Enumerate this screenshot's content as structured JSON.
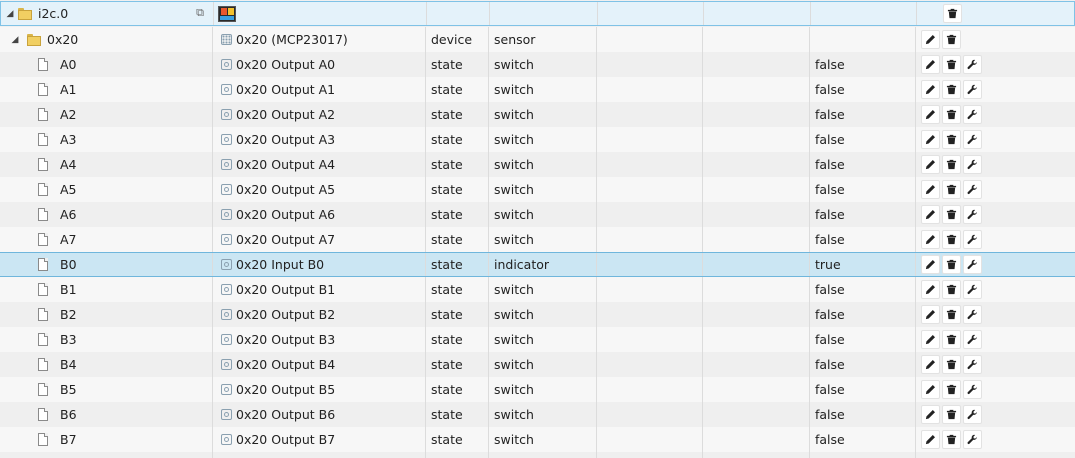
{
  "root": {
    "name": "i2c.0",
    "expander": "◢",
    "copy_icon": "⧉",
    "icon": "adapter-logo-icon"
  },
  "device": {
    "name": "0x20",
    "expander": "◢",
    "title": "0x20 (MCP23017)",
    "type": "device",
    "role": "sensor"
  },
  "states": [
    {
      "id": "A0",
      "name": "0x20 Output A0",
      "type": "state",
      "role": "switch",
      "value": "false"
    },
    {
      "id": "A1",
      "name": "0x20 Output A1",
      "type": "state",
      "role": "switch",
      "value": "false"
    },
    {
      "id": "A2",
      "name": "0x20 Output A2",
      "type": "state",
      "role": "switch",
      "value": "false"
    },
    {
      "id": "A3",
      "name": "0x20 Output A3",
      "type": "state",
      "role": "switch",
      "value": "false"
    },
    {
      "id": "A4",
      "name": "0x20 Output A4",
      "type": "state",
      "role": "switch",
      "value": "false"
    },
    {
      "id": "A5",
      "name": "0x20 Output A5",
      "type": "state",
      "role": "switch",
      "value": "false"
    },
    {
      "id": "A6",
      "name": "0x20 Output A6",
      "type": "state",
      "role": "switch",
      "value": "false"
    },
    {
      "id": "A7",
      "name": "0x20 Output A7",
      "type": "state",
      "role": "switch",
      "value": "false"
    },
    {
      "id": "B0",
      "name": "0x20 Input B0",
      "type": "state",
      "role": "indicator",
      "value": "true",
      "selected": true
    },
    {
      "id": "B1",
      "name": "0x20 Output B1",
      "type": "state",
      "role": "switch",
      "value": "false"
    },
    {
      "id": "B2",
      "name": "0x20 Output B2",
      "type": "state",
      "role": "switch",
      "value": "false"
    },
    {
      "id": "B3",
      "name": "0x20 Output B3",
      "type": "state",
      "role": "switch",
      "value": "false"
    },
    {
      "id": "B4",
      "name": "0x20 Output B4",
      "type": "state",
      "role": "switch",
      "value": "false"
    },
    {
      "id": "B5",
      "name": "0x20 Output B5",
      "type": "state",
      "role": "switch",
      "value": "false"
    },
    {
      "id": "B6",
      "name": "0x20 Output B6",
      "type": "state",
      "role": "switch",
      "value": "false"
    },
    {
      "id": "B7",
      "name": "0x20 Output B7",
      "type": "state",
      "role": "switch",
      "value": "false"
    }
  ],
  "actions": {
    "edit_icon": "pencil-icon",
    "delete_icon": "trash-icon",
    "settings_icon": "wrench-icon"
  },
  "colors": {
    "selected_row": "#cbe6f3",
    "selected_border": "#6fb6dc",
    "folder": "#f1cf62"
  }
}
